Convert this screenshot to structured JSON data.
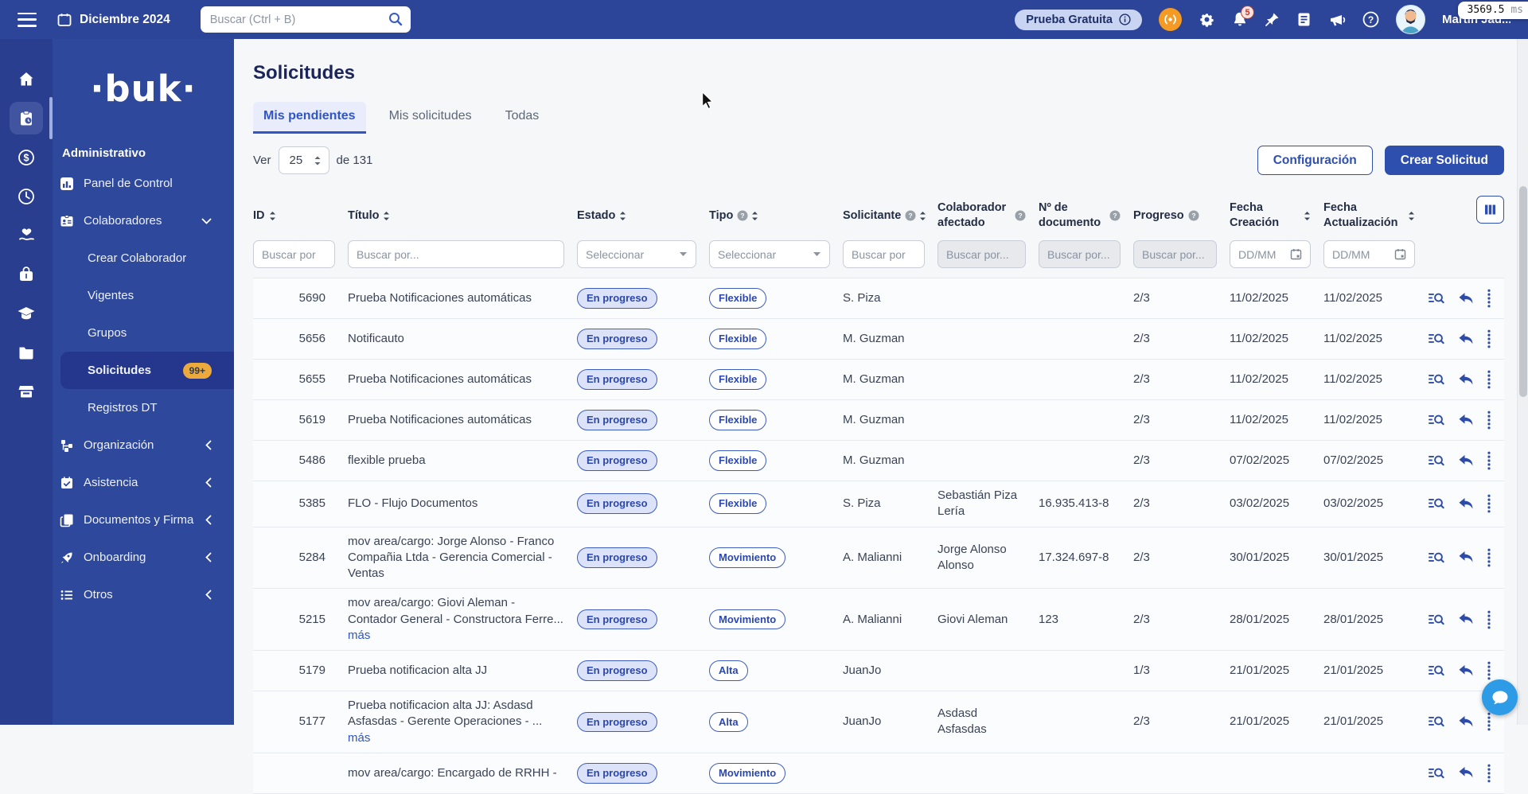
{
  "perf": {
    "value": "3569.5",
    "unit": "ms"
  },
  "navbar": {
    "date": "Diciembre 2024",
    "search_placeholder": "Buscar (Ctrl + B)",
    "trial_label": "Prueba Gratuita",
    "bell_count": "5",
    "user_name": "Martín Jad..."
  },
  "sidebar": {
    "logo": "·buk·",
    "section_title": "Administrativo",
    "panel_item": "Panel de Control",
    "colaboradores_item": "Colaboradores",
    "submenu": [
      "Crear Colaborador",
      "Vigentes",
      "Grupos",
      "Solicitudes",
      "Registros DT"
    ],
    "solicitudes_badge": "99+",
    "groups": [
      "Organización",
      "Asistencia",
      "Documentos y Firma",
      "Onboarding",
      "Otros"
    ]
  },
  "main": {
    "title": "Solicitudes",
    "tabs": [
      "Mis pendientes",
      "Mis solicitudes",
      "Todas"
    ],
    "pager": {
      "ver_label": "Ver",
      "page_size": "25",
      "total_label": "de 131"
    },
    "config_button": "Configuración",
    "create_button": "Crear Solicitud",
    "table": {
      "columns": [
        {
          "label": "ID"
        },
        {
          "label": "Título"
        },
        {
          "label": "Estado"
        },
        {
          "label": "Tipo"
        },
        {
          "label": "Solicitante"
        },
        {
          "label": "Colaborador afectado"
        },
        {
          "label": "Nº de documento"
        },
        {
          "label": "Progreso"
        },
        {
          "label": "Fecha Creación"
        },
        {
          "label": "Fecha Actualización"
        }
      ],
      "filters": {
        "id_placeholder": "Buscar por",
        "titulo_placeholder": "Buscar por...",
        "estado_placeholder": "Seleccionar",
        "tipo_placeholder": "Seleccionar",
        "solicitante_placeholder": "Buscar por",
        "colaborador_placeholder": "Buscar por...",
        "documento_placeholder": "Buscar por...",
        "progreso_placeholder": "Buscar por...",
        "fecha_creacion_placeholder": "DD/MM",
        "fecha_actualizacion_placeholder": "DD/MM"
      },
      "rows": [
        {
          "id": "5690",
          "title": "Prueba Notificaciones automáticas",
          "more": "",
          "estado": "En progreso",
          "tipo": "Flexible",
          "solicitante": "S. Piza",
          "colaborador": "",
          "documento": "",
          "progreso": "2/3",
          "creacion": "11/02/2025",
          "actualizacion": "11/02/2025"
        },
        {
          "id": "5656",
          "title": "Notificauto",
          "more": "",
          "estado": "En progreso",
          "tipo": "Flexible",
          "solicitante": "M. Guzman",
          "colaborador": "",
          "documento": "",
          "progreso": "2/3",
          "creacion": "11/02/2025",
          "actualizacion": "11/02/2025"
        },
        {
          "id": "5655",
          "title": "Prueba Notificaciones automáticas",
          "more": "",
          "estado": "En progreso",
          "tipo": "Flexible",
          "solicitante": "M. Guzman",
          "colaborador": "",
          "documento": "",
          "progreso": "2/3",
          "creacion": "11/02/2025",
          "actualizacion": "11/02/2025"
        },
        {
          "id": "5619",
          "title": "Prueba Notificaciones automáticas",
          "more": "",
          "estado": "En progreso",
          "tipo": "Flexible",
          "solicitante": "M. Guzman",
          "colaborador": "",
          "documento": "",
          "progreso": "2/3",
          "creacion": "11/02/2025",
          "actualizacion": "11/02/2025"
        },
        {
          "id": "5486",
          "title": "flexible prueba",
          "more": "",
          "estado": "En progreso",
          "tipo": "Flexible",
          "solicitante": "M. Guzman",
          "colaborador": "",
          "documento": "",
          "progreso": "2/3",
          "creacion": "07/02/2025",
          "actualizacion": "07/02/2025"
        },
        {
          "id": "5385",
          "title": "FLO - Flujo Documentos",
          "more": "",
          "estado": "En progreso",
          "tipo": "Flexible",
          "solicitante": "S. Piza",
          "colaborador": "Sebastián Piza Lería",
          "documento": "16.935.413-8",
          "progreso": "2/3",
          "creacion": "03/02/2025",
          "actualizacion": "03/02/2025"
        },
        {
          "id": "5284",
          "title": "mov area/cargo: Jorge Alonso - Franco Compañia Ltda - Gerencia Comercial - Ventas",
          "more": "",
          "estado": "En progreso",
          "tipo": "Movimiento",
          "solicitante": "A. Malianni",
          "colaborador": "Jorge Alonso Alonso",
          "documento": "17.324.697-8",
          "progreso": "2/3",
          "creacion": "30/01/2025",
          "actualizacion": "30/01/2025"
        },
        {
          "id": "5215",
          "title": "mov area/cargo: Giovi Aleman - Contador General - Constructora Ferre...",
          "more": "más",
          "estado": "En progreso",
          "tipo": "Movimiento",
          "solicitante": "A. Malianni",
          "colaborador": "Giovi Aleman",
          "documento": "123",
          "progreso": "2/3",
          "creacion": "28/01/2025",
          "actualizacion": "28/01/2025"
        },
        {
          "id": "5179",
          "title": "Prueba notificacion alta JJ",
          "more": "",
          "estado": "En progreso",
          "tipo": "Alta",
          "solicitante": "JuanJo",
          "colaborador": "",
          "documento": "",
          "progreso": "1/3",
          "creacion": "21/01/2025",
          "actualizacion": "21/01/2025"
        },
        {
          "id": "5177",
          "title": "Prueba notificacion alta JJ: Asdasd Asfasdas - Gerente Operaciones - ...",
          "more": "más",
          "estado": "En progreso",
          "tipo": "Alta",
          "solicitante": "JuanJo",
          "colaborador": "Asdasd Asfasdas",
          "documento": "",
          "progreso": "2/3",
          "creacion": "21/01/2025",
          "actualizacion": "21/01/2025"
        },
        {
          "id": "",
          "title": "mov area/cargo: Encargado de RRHH -",
          "more": "",
          "estado": "En progreso",
          "tipo": "Movimiento",
          "solicitante": "",
          "colaborador": "",
          "documento": "",
          "progreso": "",
          "creacion": "",
          "actualizacion": ""
        }
      ]
    }
  },
  "colors": {
    "topbar": "#2c4598",
    "rail": "#293e8e",
    "panel": "#2e489c",
    "active_item": "#24378c",
    "accent": "#2e4fae",
    "badge_bg": "#dce3f8",
    "amber": "#ecaa3c",
    "orange": "#f59a23",
    "danger": "#c0392b",
    "trial_bg": "#c9d4f2",
    "page_bg": "#f6f7f9",
    "row_bg": "#fbfcfe",
    "line": "#e5e8ee",
    "chat": "#2e9be6"
  }
}
